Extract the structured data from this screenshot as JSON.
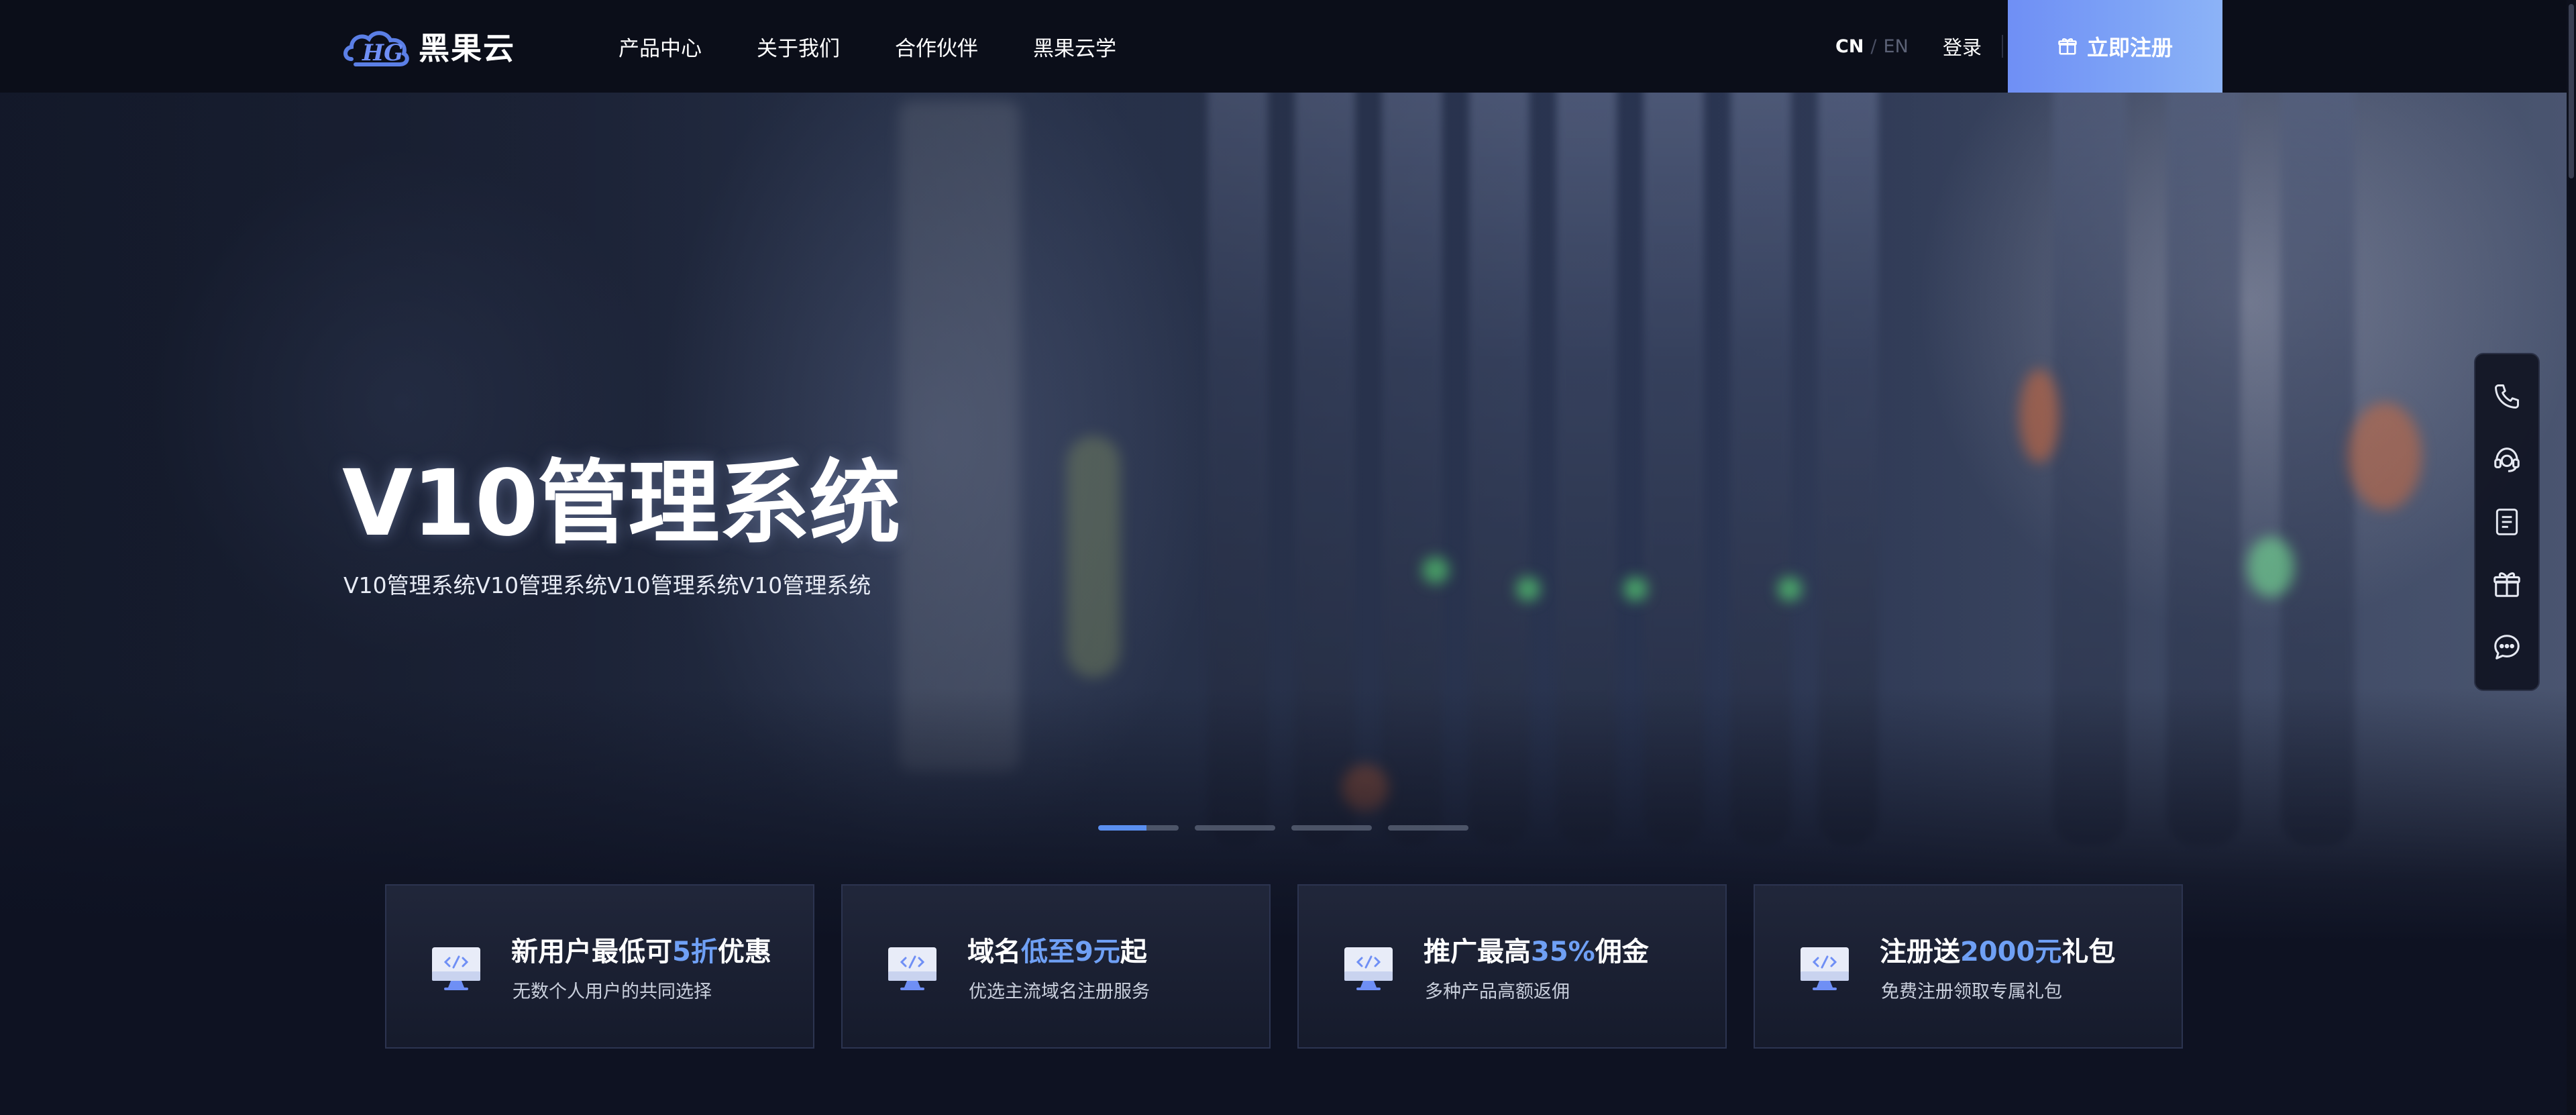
{
  "header": {
    "logo_text": "黑果云",
    "nav": [
      "产品中心",
      "关于我们",
      "合作伙伴",
      "黑果云学"
    ],
    "lang_cn": "CN",
    "lang_sep": "/",
    "lang_en": "EN",
    "login": "登录",
    "register": "立即注册"
  },
  "hero": {
    "title": "V10管理系统",
    "subtitle": "V10管理系统V10管理系统V10管理系统V10管理系统",
    "slides": 4,
    "active_slide": 1
  },
  "floatbar": {
    "icons": [
      "phone-icon",
      "customer-service-icon",
      "document-icon",
      "gift-icon",
      "chat-icon"
    ]
  },
  "cards": [
    {
      "title_pre": "新用户最低可",
      "title_hl": "5折",
      "title_post": "优惠",
      "desc": "无数个人用户的共同选择"
    },
    {
      "title_pre": "域名",
      "title_hl": "低至9元",
      "title_post": "起",
      "desc": "优选主流域名注册服务"
    },
    {
      "title_pre": "推广最高",
      "title_hl": "35%",
      "title_post": "佣金",
      "desc": "多种产品高额返佣"
    },
    {
      "title_pre": "注册送",
      "title_hl": "2000元",
      "title_post": "礼包",
      "desc": "免费注册领取专属礼包"
    }
  ],
  "colors": {
    "accent": "#6fa0f5",
    "header_bg": "#0b0e19",
    "register_bg": "#7ea4f6"
  }
}
